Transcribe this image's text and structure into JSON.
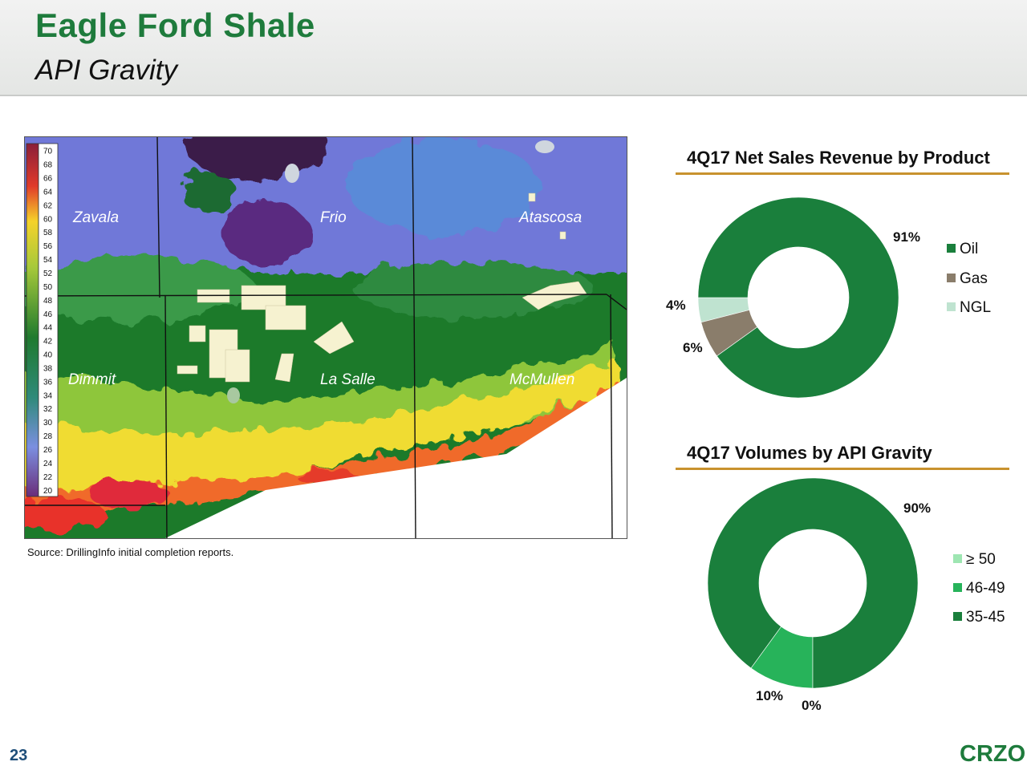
{
  "header": {
    "title": "Eagle Ford Shale",
    "subtitle": "API Gravity"
  },
  "map": {
    "scale_ticks": [
      "70",
      "68",
      "66",
      "64",
      "62",
      "60",
      "58",
      "56",
      "54",
      "52",
      "50",
      "48",
      "46",
      "44",
      "42",
      "40",
      "38",
      "36",
      "34",
      "32",
      "30",
      "28",
      "26",
      "24",
      "22",
      "20"
    ],
    "counties": [
      "Zavala",
      "Frio",
      "Atascosa",
      "Dimmit",
      "La Salle",
      "McMullen"
    ]
  },
  "source": "Source:  DrillingInfo initial completion reports.",
  "colors": {
    "brand_green": "#1e7b3c",
    "rule_gold": "#c8922e",
    "oil": "#1a7f3c",
    "gas": "#8a7d6b",
    "ngl": "#bfe3d0",
    "api_50": "#9ee6b2",
    "api_46_49": "#27b35a",
    "api_35_45": "#1a7f3c"
  },
  "chart_data": [
    {
      "type": "pie",
      "title": "4Q17 Net Sales Revenue by Product",
      "categories": [
        "Oil",
        "Gas",
        "NGL"
      ],
      "values": [
        91,
        6,
        4
      ],
      "labels": [
        "91%",
        "6%",
        "4%"
      ],
      "legend_position": "right"
    },
    {
      "type": "pie",
      "title": "4Q17 Volumes by API Gravity",
      "categories": [
        "≥ 50",
        "46-49",
        "35-45"
      ],
      "values": [
        0,
        10,
        90
      ],
      "labels": [
        "0%",
        "10%",
        "90%"
      ],
      "legend_position": "right"
    }
  ],
  "footer": {
    "page": "23",
    "logo": "CRZO"
  }
}
